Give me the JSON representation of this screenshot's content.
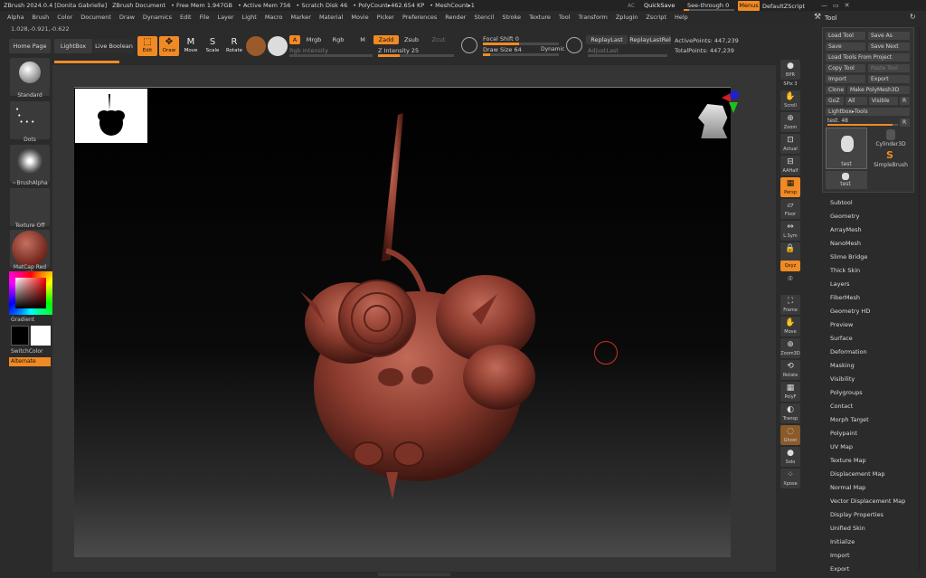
{
  "titlebar": {
    "app": "ZBrush 2024.0.4 [Donita Gabrielle]",
    "document": "ZBrush Document",
    "free_mem": "• Free Mem 1.947GB",
    "active_mem": "• Active Mem 756",
    "scratch": "• Scratch Disk 46",
    "polycount": "• PolyCount▸462.654 KP",
    "meshcount": "• MeshCount▸1",
    "ac": "AC",
    "quicksave": "QuickSave",
    "seethrough": "See-through  0",
    "menus": "Menus",
    "defaultzscript": "DefaultZScript"
  },
  "menu": [
    "Alpha",
    "Brush",
    "Color",
    "Document",
    "Draw",
    "Dynamics",
    "Edit",
    "File",
    "Layer",
    "Light",
    "Macro",
    "Marker",
    "Material",
    "Movie",
    "Picker",
    "Preferences",
    "Render",
    "Stencil",
    "Stroke",
    "Texture",
    "Tool",
    "Transform",
    "Zplugin",
    "Zscript",
    "Help"
  ],
  "coords": "1.028,-0.921,-0.622",
  "toolbar": {
    "home": "Home Page",
    "lightbox": "LightBox",
    "liveboolean": "Live Boolean",
    "edit": "Edit",
    "draw": "Draw",
    "move": "Move",
    "scale": "Scale",
    "rotate": "Rotate",
    "a": "A",
    "mrgb": "Mrgb",
    "rgb": "Rgb",
    "m": "M",
    "zadd": "Zadd",
    "zsub": "Zsub",
    "zcut": "Zcut",
    "rgb_intensity": "Rgb Intensity",
    "z_intensity": "Z Intensity 25",
    "focal_shift": "Focal Shift 0",
    "draw_size": "Draw Size 64",
    "dynamic": "Dynamic",
    "replaylast": "ReplayLast",
    "replaylastrel": "ReplayLastRel",
    "adjustlast": "AdjustLast",
    "activepoints": "ActivePoints: 447,239",
    "totalpoints": "TotalPoints: 447,239"
  },
  "leftshelf": {
    "standard": "Standard",
    "dots": "Dots",
    "brushalpha": "~BrushAlpha",
    "textureoff": "Texture Off",
    "matcap": "MatCap Red Wi",
    "gradient": "Gradient",
    "switchcolor": "SwitchColor",
    "alternate": "Alternate"
  },
  "rightshelf": [
    "BPR",
    "SPix 3",
    "Scroll",
    "Zoom",
    "Actual",
    "AAHalf",
    "Persp",
    "Floor",
    "L.Sym",
    "Qxyz",
    "",
    "Frame",
    "Move",
    "Zoom3D",
    "Rotate",
    "PolyF",
    "Transp",
    "Ghost",
    "Solo",
    "Xpose"
  ],
  "tool": {
    "title": "Tool",
    "load_tool": "Load Tool",
    "save_as": "Save As",
    "save": "Save",
    "save_next": "Save Next",
    "load_from_project": "Load Tools From Project",
    "copy_tool": "Copy Tool",
    "paste_tool": "Paste Tool",
    "import": "Import",
    "export": "Export",
    "clone": "Clone",
    "make_polymesh": "Make PolyMesh3D",
    "goz": "GoZ",
    "all": "All",
    "visible": "Visible",
    "r": "R",
    "lightbox_tools": "Lightbox▸Tools",
    "test_slider": "test. 48",
    "r2": "R",
    "thumb1": "test",
    "thumb2": "Cylinder3D",
    "thumb3": "SimpleBrush",
    "thumb4": "test"
  },
  "submenu": [
    "Subtool",
    "Geometry",
    "ArrayMesh",
    "NanoMesh",
    "Slime Bridge",
    "Thick Skin",
    "Layers",
    "FiberMesh",
    "Geometry HD",
    "Preview",
    "Surface",
    "Deformation",
    "Masking",
    "Visibility",
    "Polygroups",
    "Contact",
    "Morph Target",
    "Polypaint",
    "UV Map",
    "Texture Map",
    "Displacement Map",
    "Normal Map",
    "Vector Displacement Map",
    "Display Properties",
    "Unified Skin",
    "Initialize",
    "Import",
    "Export"
  ],
  "colors": {
    "accent": "#f08a24",
    "model": "#8a3a2d",
    "cursor": "#d0302b"
  }
}
